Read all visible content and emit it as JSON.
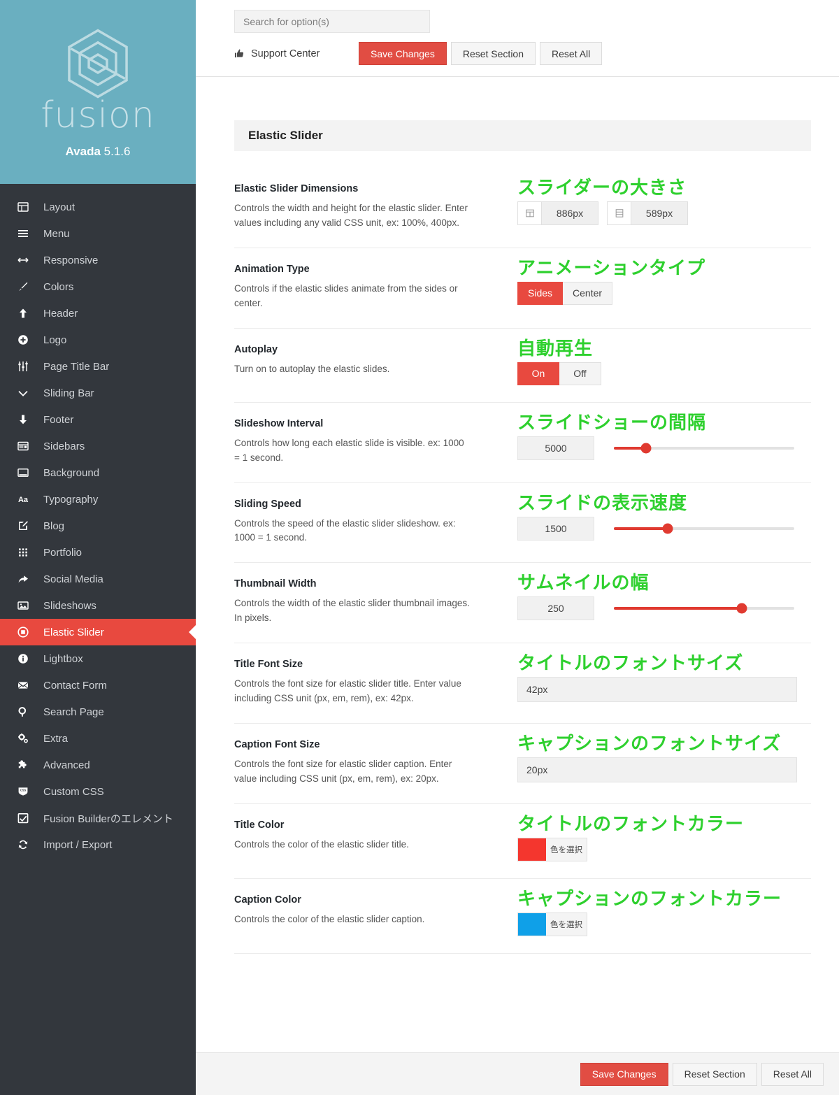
{
  "brand": {
    "logo_icon": "fusion-hexagon-logo",
    "wordmark": "fusion",
    "product": "Avada",
    "version": "5.1.6"
  },
  "sidebar": {
    "items": [
      {
        "label": "Layout",
        "icon": "layout-icon",
        "active": false
      },
      {
        "label": "Menu",
        "icon": "menu-icon",
        "active": false
      },
      {
        "label": "Responsive",
        "icon": "arrows-h-icon",
        "active": false
      },
      {
        "label": "Colors",
        "icon": "brush-icon",
        "active": false
      },
      {
        "label": "Header",
        "icon": "arrow-up-icon",
        "active": false
      },
      {
        "label": "Logo",
        "icon": "plus-circle-icon",
        "active": false
      },
      {
        "label": "Page Title Bar",
        "icon": "sliders-icon",
        "active": false
      },
      {
        "label": "Sliding Bar",
        "icon": "chevron-down-icon",
        "active": false
      },
      {
        "label": "Footer",
        "icon": "arrow-down-icon",
        "active": false
      },
      {
        "label": "Sidebars",
        "icon": "sidebars-icon",
        "active": false
      },
      {
        "label": "Background",
        "icon": "background-icon",
        "active": false
      },
      {
        "label": "Typography",
        "icon": "typography-aa-icon",
        "active": false
      },
      {
        "label": "Blog",
        "icon": "pencil-square-icon",
        "active": false
      },
      {
        "label": "Portfolio",
        "icon": "grid-icon",
        "active": false
      },
      {
        "label": "Social Media",
        "icon": "share-arrow-icon",
        "active": false
      },
      {
        "label": "Slideshows",
        "icon": "image-icon",
        "active": false
      },
      {
        "label": "Elastic Slider",
        "icon": "elastic-slider-icon",
        "active": true
      },
      {
        "label": "Lightbox",
        "icon": "info-circle-icon",
        "active": false
      },
      {
        "label": "Contact Form",
        "icon": "envelope-icon",
        "active": false
      },
      {
        "label": "Search Page",
        "icon": "search-icon",
        "active": false
      },
      {
        "label": "Extra",
        "icon": "gears-icon",
        "active": false
      },
      {
        "label": "Advanced",
        "icon": "puzzle-piece-icon",
        "active": false
      },
      {
        "label": "Custom CSS",
        "icon": "css-badge-icon",
        "active": false
      },
      {
        "label": "Fusion Builderのエレメント",
        "icon": "check-square-icon",
        "active": false
      },
      {
        "label": "Import / Export",
        "icon": "refresh-icon",
        "active": false
      }
    ]
  },
  "topbar": {
    "search_placeholder": "Search for option(s)",
    "support_label": "Support Center",
    "support_icon": "thumbs-up-icon",
    "save_label": "Save Changes",
    "reset_section_label": "Reset Section",
    "reset_all_label": "Reset All"
  },
  "section": {
    "title": "Elastic Slider"
  },
  "colors": {
    "accent_red": "#e14d43",
    "active_red": "#e8493f",
    "slider_red": "#e03a30",
    "annotation_green": "#2ed02e",
    "brand_teal": "#6aafc0",
    "sidebar_dark": "#33373d"
  },
  "rows": [
    {
      "title": "Elastic Slider Dimensions",
      "desc": "Controls the width and height for the elastic slider. Enter values including any valid CSS unit, ex: 100%, 400px.",
      "annotation": "スライダーの大きさ",
      "width_value": "886px",
      "height_value": "589px",
      "width_icon": "width-icon",
      "height_icon": "height-icon"
    },
    {
      "title": "Animation Type",
      "desc": "Controls if the elastic slides animate from the sides or center.",
      "annotation": "アニメーションタイプ",
      "options": [
        "Sides",
        "Center"
      ],
      "selected": "Sides"
    },
    {
      "title": "Autoplay",
      "desc": "Turn on to autoplay the elastic slides.",
      "annotation": "自動再生",
      "options": [
        "On",
        "Off"
      ],
      "selected": "On"
    },
    {
      "title": "Slideshow Interval",
      "desc": "Controls how long each elastic slide is visible. ex: 1000 = 1 second.",
      "annotation": "スライドショーの間隔",
      "value": "5000",
      "percent": 18
    },
    {
      "title": "Sliding Speed",
      "desc": "Controls the speed of the elastic slider slideshow. ex: 1000 = 1 second.",
      "annotation": "スライドの表示速度",
      "value": "1500",
      "percent": 30
    },
    {
      "title": "Thumbnail Width",
      "desc": "Controls the width of the elastic slider thumbnail images. In pixels.",
      "annotation": "サムネイルの幅",
      "value": "250",
      "percent": 71
    },
    {
      "title": "Title Font Size",
      "desc": "Controls the font size for elastic slider title. Enter value including CSS unit (px, em, rem), ex: 42px.",
      "annotation": "タイトルのフォントサイズ",
      "value": "42px"
    },
    {
      "title": "Caption Font Size",
      "desc": "Controls the font size for elastic slider caption. Enter value including CSS unit (px, em, rem), ex: 20px.",
      "annotation": "キャプションのフォントサイズ",
      "value": "20px"
    },
    {
      "title": "Title Color",
      "desc": "Controls the color of the elastic slider title.",
      "annotation": "タイトルのフォントカラー",
      "swatch": "#f4362e",
      "button_label": "色を選択"
    },
    {
      "title": "Caption Color",
      "desc": "Controls the color of the elastic slider caption.",
      "annotation": "キャプションのフォントカラー",
      "swatch": "#0fa0e8",
      "button_label": "色を選択"
    }
  ],
  "bottombar": {
    "save_label": "Save Changes",
    "reset_section_label": "Reset Section",
    "reset_all_label": "Reset All"
  }
}
